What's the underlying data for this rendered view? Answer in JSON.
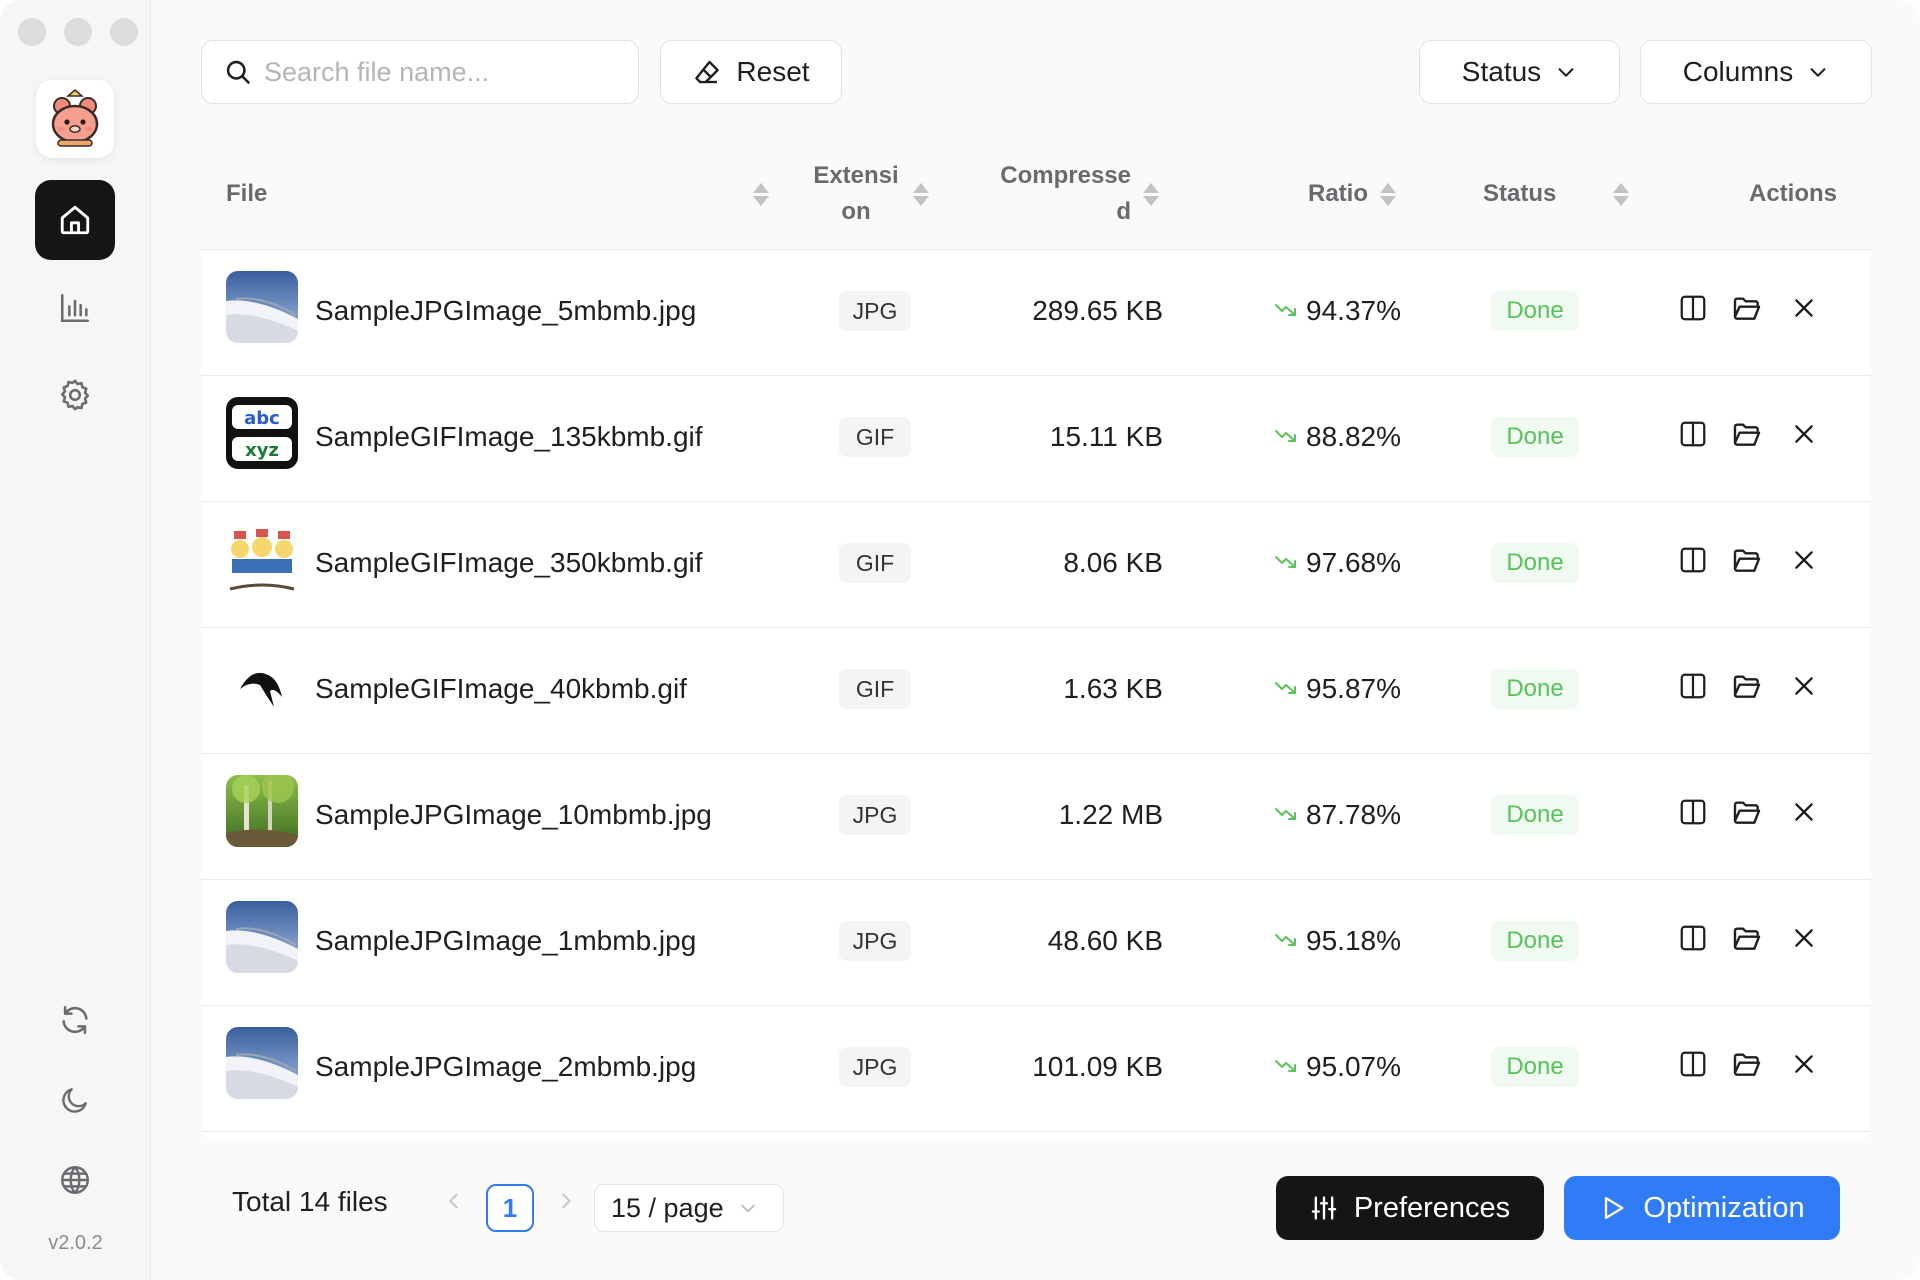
{
  "app": {
    "version": "v2.0.2"
  },
  "toolbar": {
    "search_placeholder": "Search file name...",
    "reset_label": "Reset",
    "status_label": "Status",
    "columns_label": "Columns"
  },
  "sidebar": {
    "items": [
      {
        "icon": "home-icon",
        "active": true
      },
      {
        "icon": "chart-icon",
        "active": false
      },
      {
        "icon": "gear-icon",
        "active": false
      }
    ],
    "bottom": [
      {
        "icon": "refresh-icon"
      },
      {
        "icon": "moon-icon"
      },
      {
        "icon": "globe-icon"
      }
    ]
  },
  "table": {
    "headers": {
      "file": "File",
      "extension": "Extension",
      "compressed": "Compressed",
      "ratio": "Ratio",
      "status": "Status",
      "actions": "Actions"
    },
    "rows": [
      {
        "name": "SampleJPGImage_5mbmb.jpg",
        "ext": "JPG",
        "size": "289.65 KB",
        "ratio": "94.37%",
        "status": "Done",
        "thumb": "plane"
      },
      {
        "name": "SampleGIFImage_135kbmb.gif",
        "ext": "GIF",
        "size": "15.11 KB",
        "ratio": "88.82%",
        "status": "Done",
        "thumb": "text"
      },
      {
        "name": "SampleGIFImage_350kbmb.gif",
        "ext": "GIF",
        "size": "8.06 KB",
        "ratio": "97.68%",
        "status": "Done",
        "thumb": "christmas"
      },
      {
        "name": "SampleGIFImage_40kbmb.gif",
        "ext": "GIF",
        "size": "1.63 KB",
        "ratio": "95.87%",
        "status": "Done",
        "thumb": "bird"
      },
      {
        "name": "SampleJPGImage_10mbmb.jpg",
        "ext": "JPG",
        "size": "1.22 MB",
        "ratio": "87.78%",
        "status": "Done",
        "thumb": "forest"
      },
      {
        "name": "SampleJPGImage_1mbmb.jpg",
        "ext": "JPG",
        "size": "48.60 KB",
        "ratio": "95.18%",
        "status": "Done",
        "thumb": "plane"
      },
      {
        "name": "SampleJPGImage_2mbmb.jpg",
        "ext": "JPG",
        "size": "101.09 KB",
        "ratio": "95.07%",
        "status": "Done",
        "thumb": "plane"
      }
    ]
  },
  "footer": {
    "total_label": "Total 14 files",
    "current_page": "1",
    "per_page": "15 / page",
    "preferences_label": "Preferences",
    "optimization_label": "Optimization"
  },
  "colors": {
    "accent": "#2f7cf6",
    "success": "#58c35a",
    "dark": "#151515"
  }
}
